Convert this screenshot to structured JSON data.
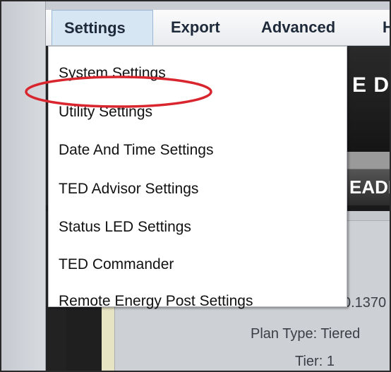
{
  "menubar": {
    "items": [
      {
        "label": "Settings",
        "active": true
      },
      {
        "label": "Export"
      },
      {
        "label": "Advanced"
      },
      {
        "label": "H"
      }
    ]
  },
  "dropdown": {
    "items": [
      {
        "label": "System Settings"
      },
      {
        "label": "Utility Settings",
        "highlighted": true
      },
      {
        "label": "Date And Time Settings"
      },
      {
        "label": "TED Advisor Settings"
      },
      {
        "label": "Status LED Settings"
      },
      {
        "label": "TED Commander"
      },
      {
        "label": "Remote Energy Post Settings"
      }
    ]
  },
  "background": {
    "title_fragment": "E DA",
    "tab_fragment": "EADI",
    "value_fragment_1": "7",
    "value_fragment_2": "0.1370",
    "plan_type": "Plan Type: Tiered",
    "tier": "Tier: 1"
  },
  "colors": {
    "highlight_ellipse": "#d9262e",
    "menu_active_bg": "#d7e6f3",
    "app_dark": "#222222"
  }
}
